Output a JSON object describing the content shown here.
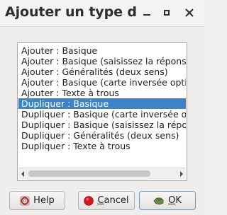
{
  "window": {
    "title": "Ajouter un type d..."
  },
  "list": {
    "items": [
      "Ajouter  : Basique",
      "Ajouter  : Basique (saisissez la réponse)",
      "Ajouter  : Généralités (deux sens)",
      "Ajouter  : Basique (carte inversée optionnelle)",
      "Ajouter  : Texte à trous",
      "Dupliquer  : Basique",
      "Dupliquer  : Basique (carte inversée optionnelle)",
      "Dupliquer  : Basique (saisissez la réponse)",
      "Dupliquer  : Généralités (deux sens)",
      "Dupliquer  : Texte à trous"
    ],
    "selected_index": 5
  },
  "buttons": {
    "help_label": "Help",
    "cancel_label_first": "C",
    "cancel_label_rest": "ancel",
    "ok_label_first": "O",
    "ok_label_rest": "K"
  },
  "colors": {
    "selection": "#3a84c7",
    "cancel_icon": "#d9141b",
    "help_icon": "#c2282a"
  },
  "icons": {
    "help": "help-lifebuoy-icon",
    "cancel": "cancel-red-circle-icon",
    "ok": "ok-hand-icon",
    "minimize": "minimize-icon",
    "maximize": "maximize-icon",
    "close": "close-icon"
  }
}
